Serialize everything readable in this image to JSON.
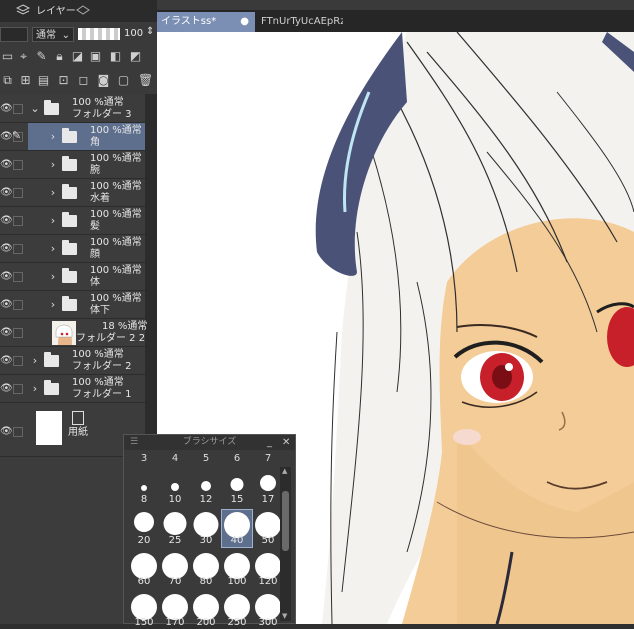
{
  "panel_tabs": {
    "layer_tab": "レイヤー"
  },
  "layer_props": {
    "blend_mode": "通常",
    "opacity": "100"
  },
  "layers": [
    {
      "opacity_mode": "100 %通常",
      "name": "フォルダー 3",
      "type": "folder",
      "open": true,
      "indent": 0
    },
    {
      "opacity_mode": "100 %通常",
      "name": "角",
      "type": "folder",
      "open": false,
      "indent": 1,
      "selected": true
    },
    {
      "opacity_mode": "100 %通常",
      "name": "腕",
      "type": "folder",
      "open": false,
      "indent": 1
    },
    {
      "opacity_mode": "100 %通常",
      "name": "水着",
      "type": "folder",
      "open": false,
      "indent": 1
    },
    {
      "opacity_mode": "100 %通常",
      "name": "髪",
      "type": "folder",
      "open": false,
      "indent": 1
    },
    {
      "opacity_mode": "100 %通常",
      "name": "顔",
      "type": "folder",
      "open": false,
      "indent": 1
    },
    {
      "opacity_mode": "100 %通常",
      "name": "体",
      "type": "folder",
      "open": false,
      "indent": 1
    },
    {
      "opacity_mode": "100 %通常",
      "name": "体下",
      "type": "folder",
      "open": false,
      "indent": 1
    },
    {
      "opacity_mode": "18 %通常",
      "name": "フォルダー 2 2",
      "type": "image",
      "indent": 1
    },
    {
      "opacity_mode": "100 %通常",
      "name": "フォルダー 2",
      "type": "folder",
      "open": false,
      "indent": 0
    },
    {
      "opacity_mode": "100 %通常",
      "name": "フォルダー 1",
      "type": "folder",
      "open": false,
      "indent": 0
    },
    {
      "opacity_mode": "",
      "name": "用紙",
      "type": "paper",
      "indent": 0
    }
  ],
  "doc_tabs": [
    {
      "label": "イラストss*",
      "active": true
    },
    {
      "label": "FTnUrTyUcAEpRz"
    }
  ],
  "brush_palette": {
    "title": "ブラシサイズ",
    "top_row": [
      "3",
      "4",
      "5",
      "6",
      "7"
    ],
    "sizes": [
      {
        "label": "8",
        "selected": false
      },
      {
        "label": "10",
        "selected": false
      },
      {
        "label": "12",
        "selected": false
      },
      {
        "label": "15",
        "selected": false
      },
      {
        "label": "17",
        "selected": false
      },
      {
        "label": "20",
        "selected": false
      },
      {
        "label": "25",
        "selected": false
      },
      {
        "label": "30",
        "selected": false
      },
      {
        "label": "40",
        "selected": true
      },
      {
        "label": "50",
        "selected": false
      },
      {
        "label": "60",
        "selected": false
      },
      {
        "label": "70",
        "selected": false
      },
      {
        "label": "80",
        "selected": false
      },
      {
        "label": "100",
        "selected": false
      },
      {
        "label": "120",
        "selected": false
      },
      {
        "label": "150",
        "selected": false
      },
      {
        "label": "170",
        "selected": false
      },
      {
        "label": "200",
        "selected": false
      },
      {
        "label": "250",
        "selected": false
      },
      {
        "label": "300",
        "selected": false
      }
    ]
  },
  "colors": {
    "selection": "#5e6f8e",
    "panel": "#3a3a3a",
    "horn": "#4a5377",
    "hair": "#f4f2ef",
    "skin": "#f3cc97",
    "eye": "#c8202a"
  }
}
